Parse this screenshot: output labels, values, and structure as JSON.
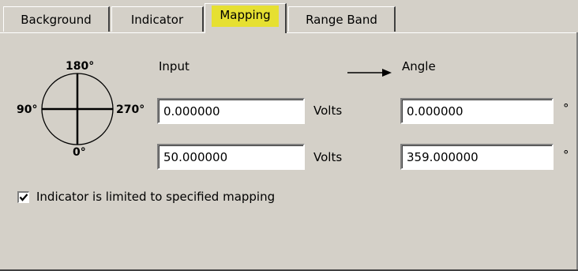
{
  "tabs": [
    {
      "label": "Background",
      "active": false
    },
    {
      "label": "Indicator",
      "active": false
    },
    {
      "label": "Mapping",
      "active": true
    },
    {
      "label": "Range Band",
      "active": false
    }
  ],
  "dial": {
    "top_label": "180°",
    "left_label": "90°",
    "right_label": "270°",
    "bottom_label": "0°"
  },
  "headers": {
    "input": "Input",
    "angle": "Angle"
  },
  "rows": [
    {
      "input_value": "0.000000",
      "unit": "Volts",
      "angle_value": "0.000000",
      "angle_unit": "°"
    },
    {
      "input_value": "50.000000",
      "unit": "Volts",
      "angle_value": "359.000000",
      "angle_unit": "°"
    }
  ],
  "checkbox": {
    "label": "Indicator is limited to specified mapping",
    "checked": true
  },
  "colors": {
    "background": "#d4d0c8",
    "active_tab_highlight": "#e6e032"
  }
}
